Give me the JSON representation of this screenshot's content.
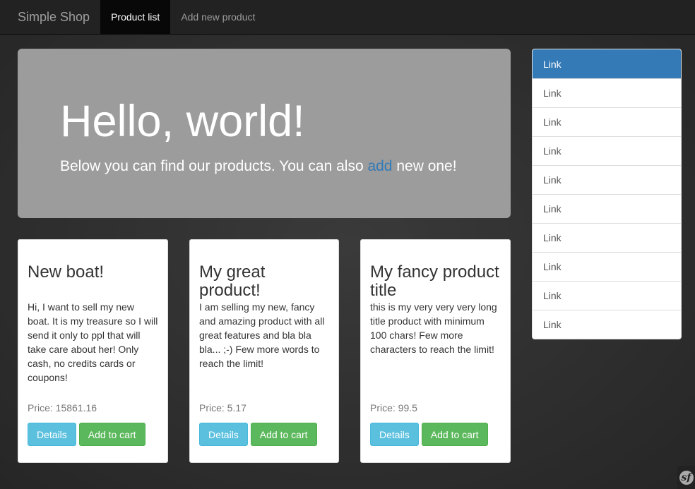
{
  "navbar": {
    "brand": "Simple Shop",
    "links": [
      {
        "label": "Product list",
        "active": true
      },
      {
        "label": "Add new product",
        "active": false
      }
    ]
  },
  "jumbotron": {
    "heading": "Hello, world!",
    "text_before": "Below you can find our products. You can also ",
    "link_text": "add",
    "text_after": " new one!"
  },
  "products": [
    {
      "title": "New boat!",
      "description": "Hi, I want to sell my new boat. It is my treasure so I will send it only to ppl that will take care about her! Only cash, no credits cards or coupons!",
      "price": "Price: 15861.16",
      "details_label": "Details",
      "cart_label": "Add to cart"
    },
    {
      "title": "My great product!",
      "description": "I am selling my new, fancy and amazing product with all great features and bla bla bla... ;-) Few more words to reach the limit!",
      "price": "Price: 5.17",
      "details_label": "Details",
      "cart_label": "Add to cart"
    },
    {
      "title": "My fancy product title",
      "description": "this is my very very very long title product with minimum 100 chars! Few more characters to reach the limit!",
      "price": "Price: 99.5",
      "details_label": "Details",
      "cart_label": "Add to cart"
    }
  ],
  "sidebar": {
    "items": [
      "Link",
      "Link",
      "Link",
      "Link",
      "Link",
      "Link",
      "Link",
      "Link",
      "Link",
      "Link"
    ]
  },
  "debug_toolbar": {
    "icon": "symfony-logo-icon",
    "glyph": "sf"
  },
  "colors": {
    "primary": "#337ab7",
    "info": "#5bc0de",
    "success": "#5cb85c",
    "navbar": "#222222",
    "jumbotron": "#9c9c9c"
  }
}
